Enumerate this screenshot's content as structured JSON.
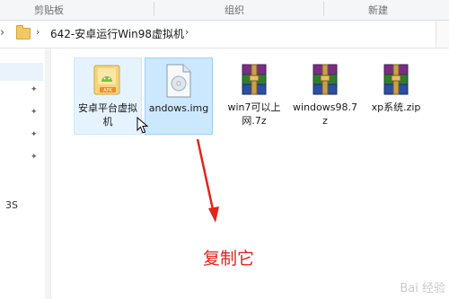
{
  "ribbon": {
    "groups": [
      "剪贴板",
      "组织",
      "新建"
    ]
  },
  "address": {
    "path": "642-安卓运行Win98虚拟机"
  },
  "nav": {
    "item_label": "3S"
  },
  "files": [
    {
      "name": "安卓平台虚拟机",
      "icon": "apk-installer-icon",
      "state": "hover"
    },
    {
      "name": "andows.img",
      "icon": "disc-image-icon",
      "state": "selected"
    },
    {
      "name": "win7可以上网.7z",
      "icon": "winrar-archive-icon",
      "state": "normal"
    },
    {
      "name": "windows98.7z",
      "icon": "winrar-archive-icon",
      "state": "normal"
    },
    {
      "name": "xp系统.zip",
      "icon": "winrar-archive-icon",
      "state": "normal"
    }
  ],
  "annotation": {
    "text": "复制它",
    "color": "#e4231c"
  },
  "watermark": {
    "text": "Bai 经验"
  },
  "colors": {
    "selection": "#cce8ff",
    "hover": "#e5f3ff",
    "folder": "#f2c866"
  }
}
